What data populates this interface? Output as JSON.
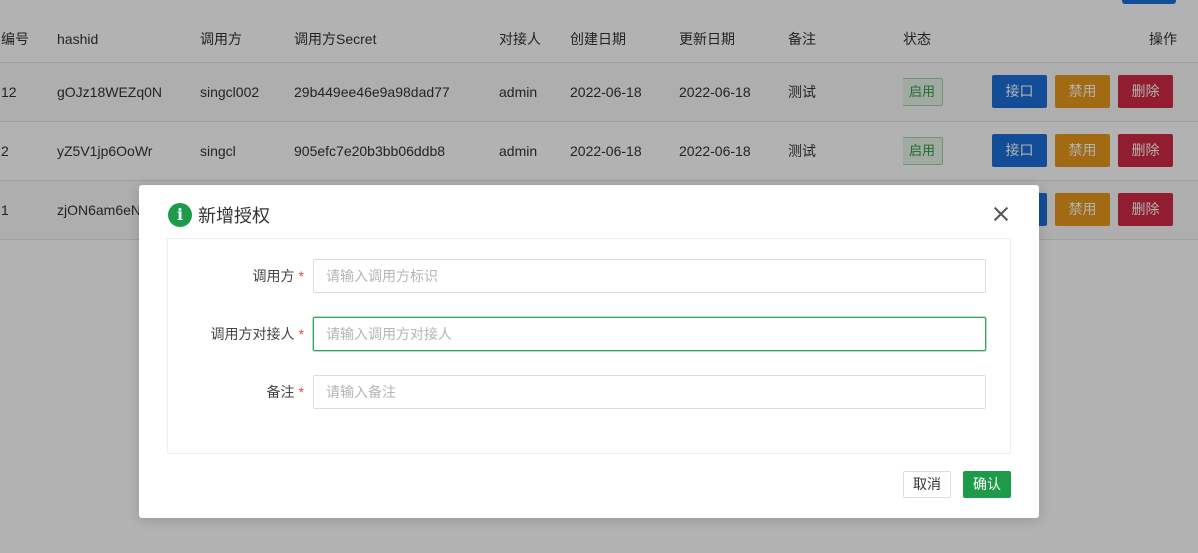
{
  "table": {
    "headers": [
      "编号",
      "hashid",
      "调用方",
      "调用方Secret",
      "对接人",
      "创建日期",
      "更新日期",
      "备注",
      "状态",
      "操作"
    ],
    "rows": [
      {
        "id": "12",
        "hashid": "gOJz18WEZq0N",
        "caller": "singcl002",
        "secret": "29b449ee46e9a98dad77",
        "contact": "admin",
        "created": "2022-06-18",
        "updated": "2022-06-18",
        "remark": "测试",
        "status": "启用",
        "api_label": "接口",
        "disable_label": "禁用",
        "delete_label": "删除"
      },
      {
        "id": "2",
        "hashid": "yZ5V1jp6OoWr",
        "caller": "singcl",
        "secret": "905efc7e20b3bb06ddb8",
        "contact": "admin",
        "created": "2022-06-18",
        "updated": "2022-06-18",
        "remark": "测试",
        "status": "启用",
        "api_label": "接口",
        "disable_label": "禁用",
        "delete_label": "删除"
      },
      {
        "id": "1",
        "hashid": "zjON6am6eN",
        "caller": "",
        "secret": "",
        "contact": "",
        "created": "",
        "updated": "",
        "remark": "",
        "status": "",
        "api_label": "",
        "disable_label": "禁用",
        "delete_label": "删除"
      }
    ]
  },
  "modal": {
    "title": "新增授权",
    "icon": "info-icon",
    "fields": [
      {
        "label": "调用方",
        "placeholder": "请输入调用方标识",
        "value": "",
        "required": "*"
      },
      {
        "label": "调用方对接人",
        "placeholder": "请输入调用方对接人",
        "value": "",
        "required": "*"
      },
      {
        "label": "备注",
        "placeholder": "请输入备注",
        "value": "",
        "required": "*"
      }
    ],
    "cancel_label": "取消",
    "ok_label": "确认"
  },
  "colors": {
    "primary": "#1e6fd9",
    "warning": "#e89a1c",
    "danger": "#d22a46",
    "success": "#1d9b4b"
  }
}
